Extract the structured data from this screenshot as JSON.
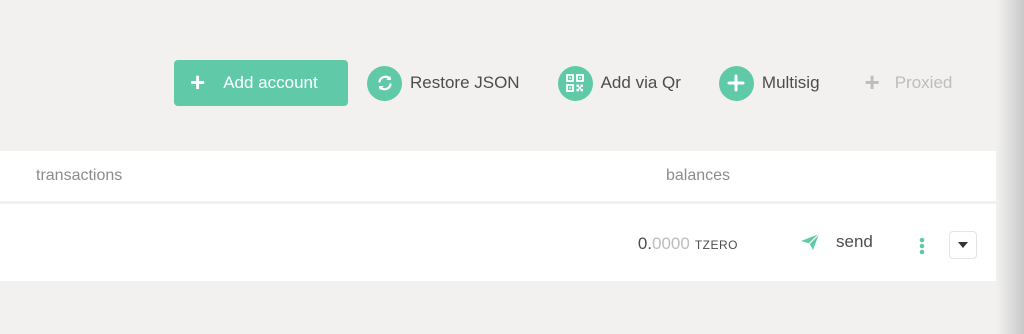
{
  "toolbar": {
    "add_account": "Add account",
    "restore_json": "Restore JSON",
    "add_via_qr": "Add via Qr",
    "multisig": "Multisig",
    "proxied": "Proxied"
  },
  "table": {
    "headers": {
      "transactions": "transactions",
      "balances": "balances"
    },
    "rows": [
      {
        "balance_int": "0.",
        "balance_dec": "0000",
        "unit": "TZERO",
        "send_label": "send"
      }
    ]
  },
  "icons": {
    "add": "plus-icon",
    "restore": "refresh-icon",
    "qr": "qr-code-icon",
    "multisig": "plus-icon",
    "proxied": "plus-icon",
    "send": "paper-plane-icon",
    "more": "kebab-menu-icon",
    "dropdown": "caret-down-icon"
  },
  "colors": {
    "accent": "#5fc9a8",
    "background": "#f2f1f0",
    "text": "#4d4d4d",
    "muted": "#8c8c8c",
    "disabled": "#bdbdbd"
  }
}
